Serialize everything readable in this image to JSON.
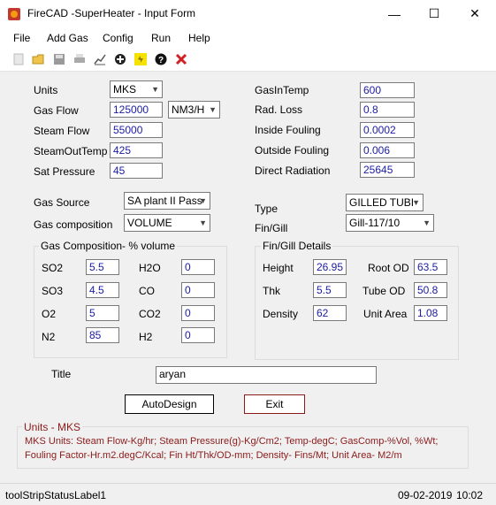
{
  "window": {
    "title": "FireCAD -SuperHeater - Input Form",
    "minimize": "—",
    "maximize": "☐",
    "close": "✕"
  },
  "menu": {
    "file": "File",
    "add_gas": "Add Gas",
    "config": "Config",
    "run": "Run",
    "help": "Help"
  },
  "toolbar": {
    "icons": [
      "new-icon",
      "open-icon",
      "save-icon",
      "print-icon",
      "chart-icon",
      "add-icon",
      "run-icon",
      "help-icon",
      "delete-icon"
    ]
  },
  "form": {
    "units": {
      "label": "Units",
      "value": "MKS"
    },
    "gas_flow": {
      "label": "Gas Flow",
      "value": "125000",
      "unit": "NM3/H"
    },
    "steam_flow": {
      "label": "Steam Flow",
      "value": "55000"
    },
    "steam_out_temp": {
      "label": "SteamOutTemp",
      "value": "425"
    },
    "sat_pressure": {
      "label": "Sat Pressure",
      "value": "45"
    },
    "gas_in_temp": {
      "label": "GasInTemp",
      "value": "600"
    },
    "rad_loss": {
      "label": "Rad. Loss",
      "value": "0.8"
    },
    "inside_fouling": {
      "label": "Inside Fouling",
      "value": "0.0002"
    },
    "outside_fouling": {
      "label": "Outside Fouling",
      "value": "0.006"
    },
    "direct_radiation": {
      "label": "Direct Radiation",
      "value": "25645"
    },
    "gas_source": {
      "label": "Gas Source",
      "value": "SA plant II Pass"
    },
    "gas_composition": {
      "label": "Gas composition",
      "value": "VOLUME"
    },
    "type": {
      "label": "Type",
      "value": "GILLED TUBI"
    },
    "fin_gill": {
      "label": "Fin/Gill",
      "value": "Gill-117/10"
    }
  },
  "gas_comp": {
    "title": "Gas Composition- % volume",
    "so2": {
      "label": "SO2",
      "value": "5.5"
    },
    "so3": {
      "label": "SO3",
      "value": "4.5"
    },
    "o2": {
      "label": "O2",
      "value": "5"
    },
    "n2": {
      "label": "N2",
      "value": "85"
    },
    "h2o": {
      "label": "H2O",
      "value": "0"
    },
    "co": {
      "label": "CO",
      "value": "0"
    },
    "co2": {
      "label": "CO2",
      "value": "0"
    },
    "h2": {
      "label": "H2",
      "value": "0"
    }
  },
  "fin_details": {
    "title": "Fin/Gill Details",
    "height": {
      "label": "Height",
      "value": "26.95"
    },
    "thk": {
      "label": "Thk",
      "value": "5.5"
    },
    "density": {
      "label": "Density",
      "value": "62"
    },
    "root_od": {
      "label": "Root OD",
      "value": "63.5"
    },
    "tube_od": {
      "label": "Tube OD",
      "value": "50.8"
    },
    "unit_area": {
      "label": "Unit Area",
      "value": "1.08"
    }
  },
  "title_field": {
    "label": "Title",
    "value": "aryan"
  },
  "buttons": {
    "auto_design": "AutoDesign",
    "exit": "Exit"
  },
  "units_info": {
    "title": "Units - MKS",
    "text": "MKS Units: Steam Flow-Kg/hr; Steam Pressure(g)-Kg/Cm2; Temp-degC; GasComp-%Vol, %Wt; Fouling Factor-Hr.m2.degC/Kcal; Fin Ht/Thk/OD-mm; Density- Fins/Mt; Unit Area- M2/m"
  },
  "status": {
    "label": "toolStripStatusLabel1",
    "date": "09-02-2019",
    "time": "10:02"
  },
  "colors": {
    "value_text": "#1a1aa6",
    "units_text": "#8b1a1a",
    "exit_border": "#8b1a1a"
  }
}
